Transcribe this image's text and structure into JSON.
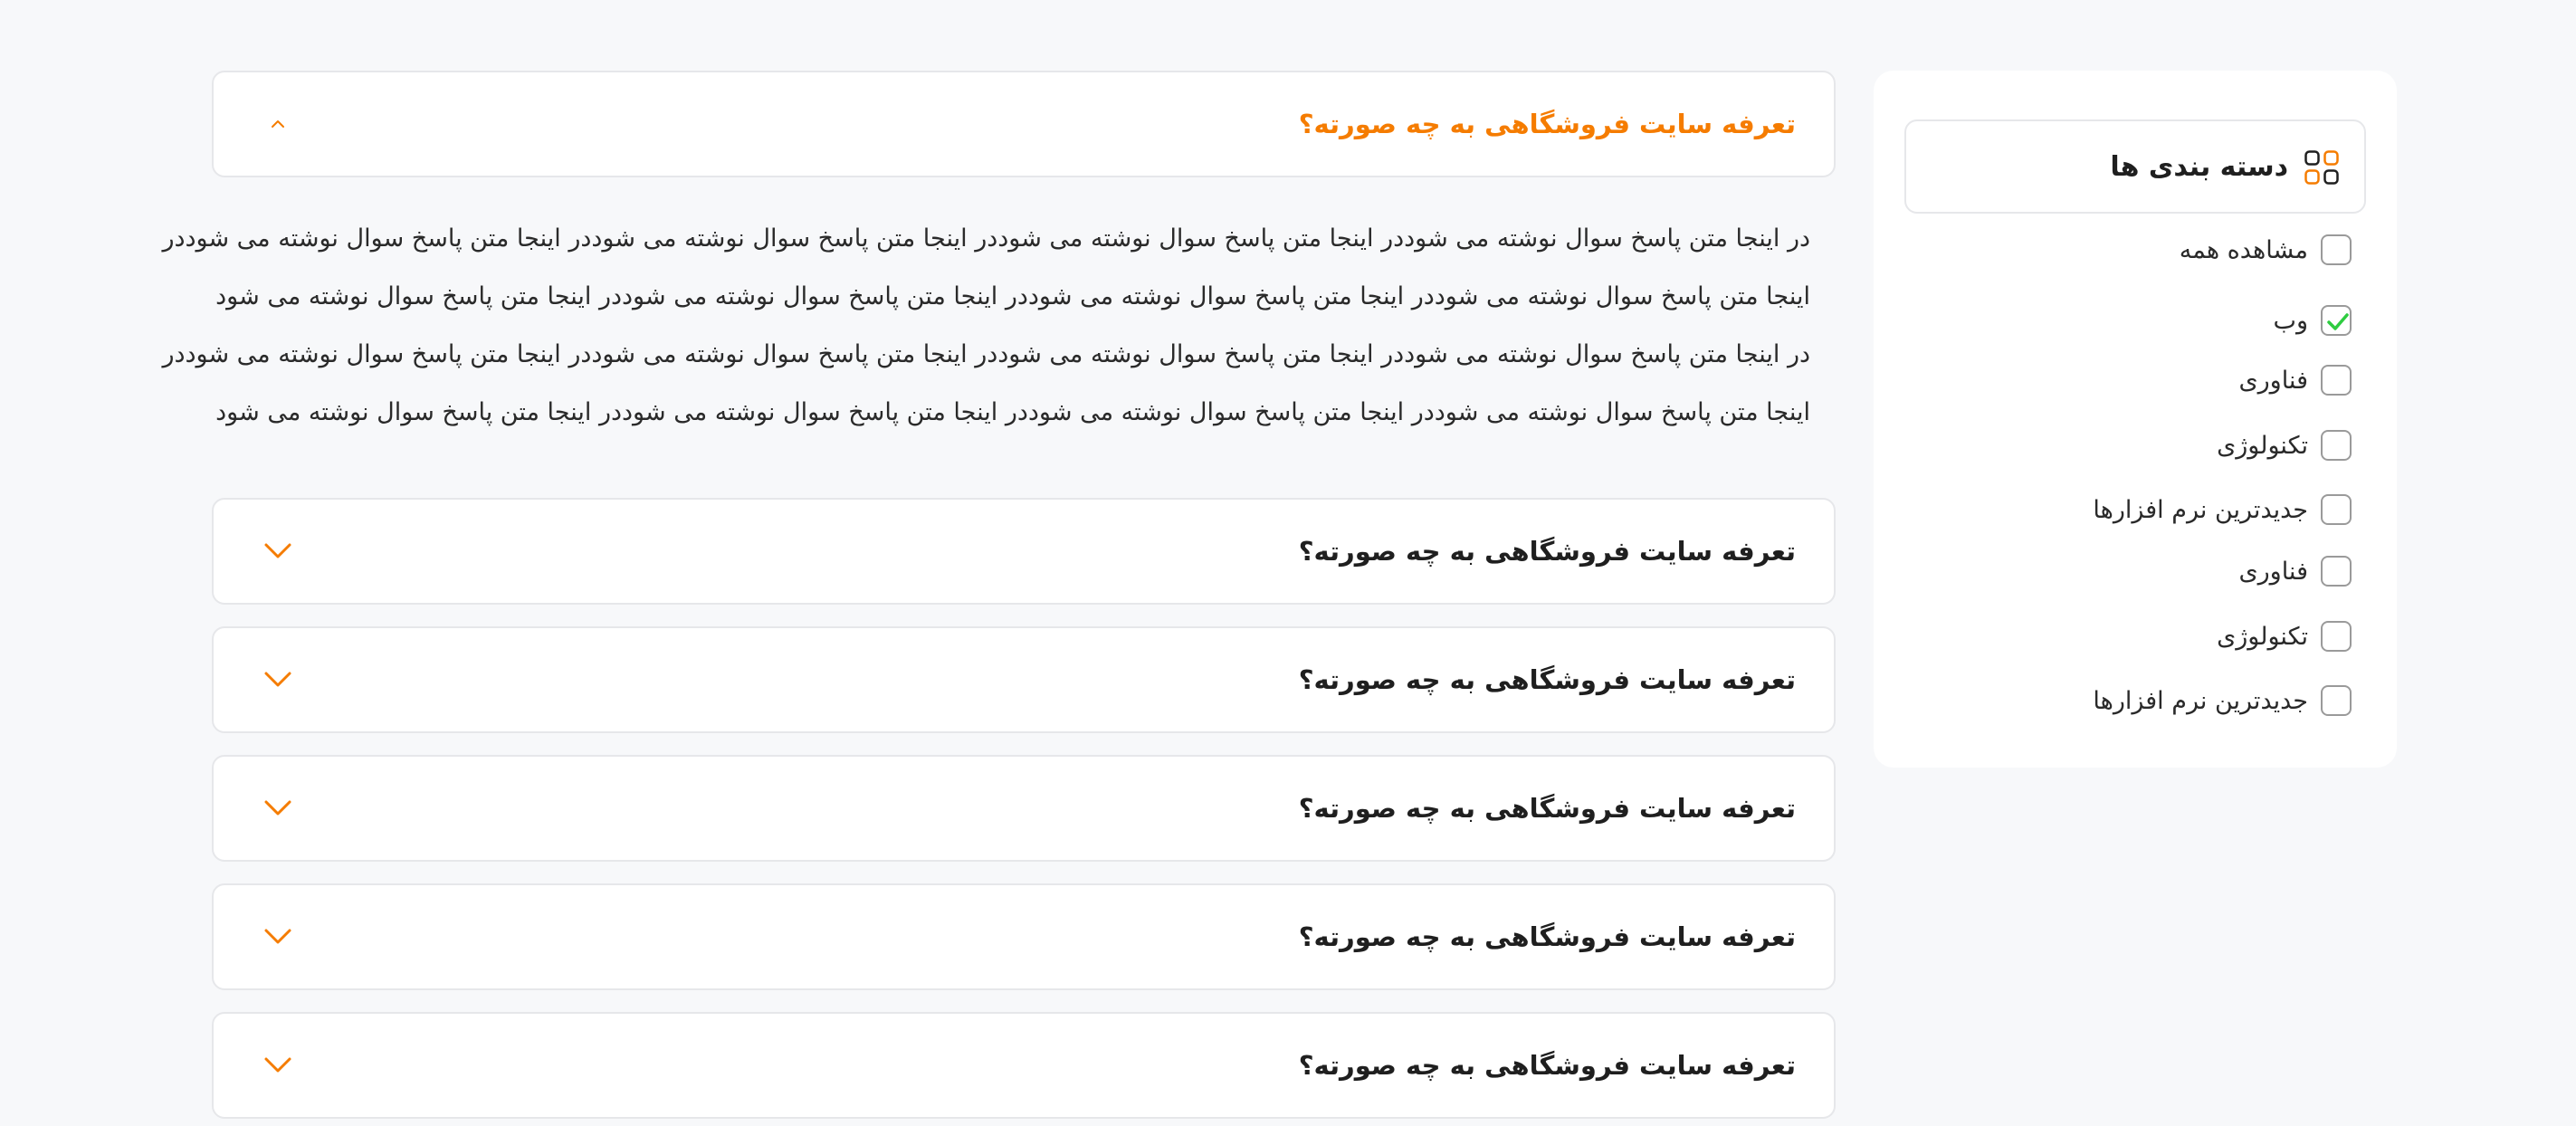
{
  "colors": {
    "accent": "#f57c00",
    "check": "#2ecc40",
    "border": "#e6e7ea",
    "background": "#f7f8fa"
  },
  "faq": {
    "items": [
      {
        "question": "تعرفه سایت فروشگاهی  به چه صورته؟",
        "open": true,
        "icon": "chevron-up-icon"
      },
      {
        "question": "تعرفه سایت فروشگاهی  به چه صورته؟",
        "open": false,
        "icon": "chevron-down-icon"
      },
      {
        "question": "تعرفه سایت فروشگاهی  به چه صورته؟",
        "open": false,
        "icon": "chevron-down-icon"
      },
      {
        "question": "تعرفه سایت فروشگاهی  به چه صورته؟",
        "open": false,
        "icon": "chevron-down-icon"
      },
      {
        "question": "تعرفه سایت فروشگاهی  به چه صورته؟",
        "open": false,
        "icon": "chevron-down-icon"
      },
      {
        "question": "تعرفه سایت فروشگاهی  به چه صورته؟",
        "open": false,
        "icon": "chevron-down-icon"
      }
    ],
    "answer_lines": [
      "در اینجا متن پاسخ سوال نوشته می شوددر اینجا متن پاسخ سوال نوشته می شوددر اینجا متن پاسخ سوال نوشته می شوددر اینجا متن پاسخ سوال نوشته می شوددر",
      "اینجا متن پاسخ سوال نوشته می شوددر اینجا متن پاسخ سوال نوشته می شوددر اینجا متن پاسخ سوال نوشته می شوددر اینجا متن پاسخ سوال نوشته می شود",
      "در اینجا متن پاسخ سوال نوشته می شوددر اینجا متن پاسخ سوال نوشته می شوددر اینجا متن پاسخ سوال نوشته می شوددر اینجا متن پاسخ سوال نوشته می شوددر",
      "اینجا متن پاسخ سوال نوشته می شوددر اینجا متن پاسخ سوال نوشته می شوددر اینجا متن پاسخ سوال نوشته می شوددر اینجا متن پاسخ سوال نوشته می شود"
    ]
  },
  "categories": {
    "title": "دسته بندی ها",
    "icon": "category-grid-icon",
    "items": [
      {
        "label": "مشاهده همه",
        "checked": false
      },
      {
        "label": "وب",
        "checked": true
      },
      {
        "label": "فناوری",
        "checked": false
      },
      {
        "label": "تکنولوژی",
        "checked": false
      },
      {
        "label": "جدیدترین نرم افزارها",
        "checked": false
      },
      {
        "label": "فناوری",
        "checked": false
      },
      {
        "label": "تکنولوژی",
        "checked": false
      },
      {
        "label": "جدیدترین نرم افزارها",
        "checked": false
      }
    ]
  }
}
